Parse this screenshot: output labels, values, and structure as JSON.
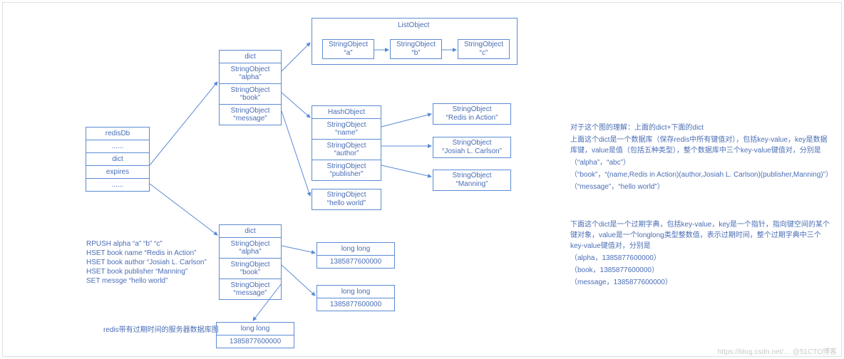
{
  "redisDb": {
    "title": "redisDb",
    "dots1": "......",
    "dict": "dict",
    "expires": "expires",
    "dots2": "......"
  },
  "commands": {
    "l1": "RPUSH  alpha  “a”  “b”  “c”",
    "l2": "HSET book name  “Redis in Action”",
    "l3": "HSET book author  “Josiah L. Carlson”",
    "l4": "HSET book publisher   “Manning”",
    "l5": "SET messge  “hello world”"
  },
  "caption": "redis带有过期时间的服务器数据库图",
  "dict1": {
    "title": "dict",
    "r1a": "StringObject",
    "r1b": "“alpha”",
    "r2a": "StringObject",
    "r2b": "“book”",
    "r3a": "StringObject",
    "r3b": "“message”"
  },
  "listTitle": "ListObject",
  "list": {
    "a1": "StringObject",
    "a2": "“a”",
    "b1": "StringObject",
    "b2": "“b”",
    "c1": "StringObject",
    "c2": "“c”"
  },
  "hash": {
    "title": "HashObject",
    "r1a": "StringObject",
    "r1b": "“name”",
    "r2a": "StringObject",
    "r2b": "“author”",
    "r3a": "StringObject",
    "r3b": "“publisher”"
  },
  "hv": {
    "v1a": "StringObject",
    "v1b": "“Redis in Action”",
    "v2a": "StringObject",
    "v2b": "“Josiah L. Carlson”",
    "v3a": "StringObject",
    "v3b": "“Manning”"
  },
  "hello": {
    "a": "StringObject",
    "b": "“hello world”"
  },
  "dict2": {
    "title": "dict",
    "r1a": "StringObject",
    "r1b": "“alpha”",
    "r2a": "StringObject",
    "r2b": "“book”",
    "r3a": "StringObject",
    "r3b": "“message”"
  },
  "ll": {
    "t": "long long",
    "v": "1385877600000"
  },
  "explain1": {
    "p1": "对于这个图的理解：上面的dict+下面的dict",
    "p2": "上面这个dict是一个数据库（保存redis中所有键值对），包括key-value，key是数据库键，value是值（包括五种类型），整个数据库中三个key-value键值对，分别是",
    "p3": "（“alpha”，“abc”）",
    "p4": "（“book”，“(name,Redis in Action)(author,Josiah L. Carlson)(publisher,Manning)”）",
    "p5": "（“message”，“hello world”）"
  },
  "explain2": {
    "p1": "下面这个dict是一个过期字典，包括key-value，key是一个指针，指向键空间的某个键对象，value是一个longlong类型整数值，表示过期时间，整个过期字典中三个key-value键值对，分别是",
    "p2": "（alpha，1385877600000）",
    "p3": "（book，1385877600000）",
    "p4": "（message，1385877600000）"
  },
  "watermark": "https://blog.csdn.net/… @51CTO博客"
}
